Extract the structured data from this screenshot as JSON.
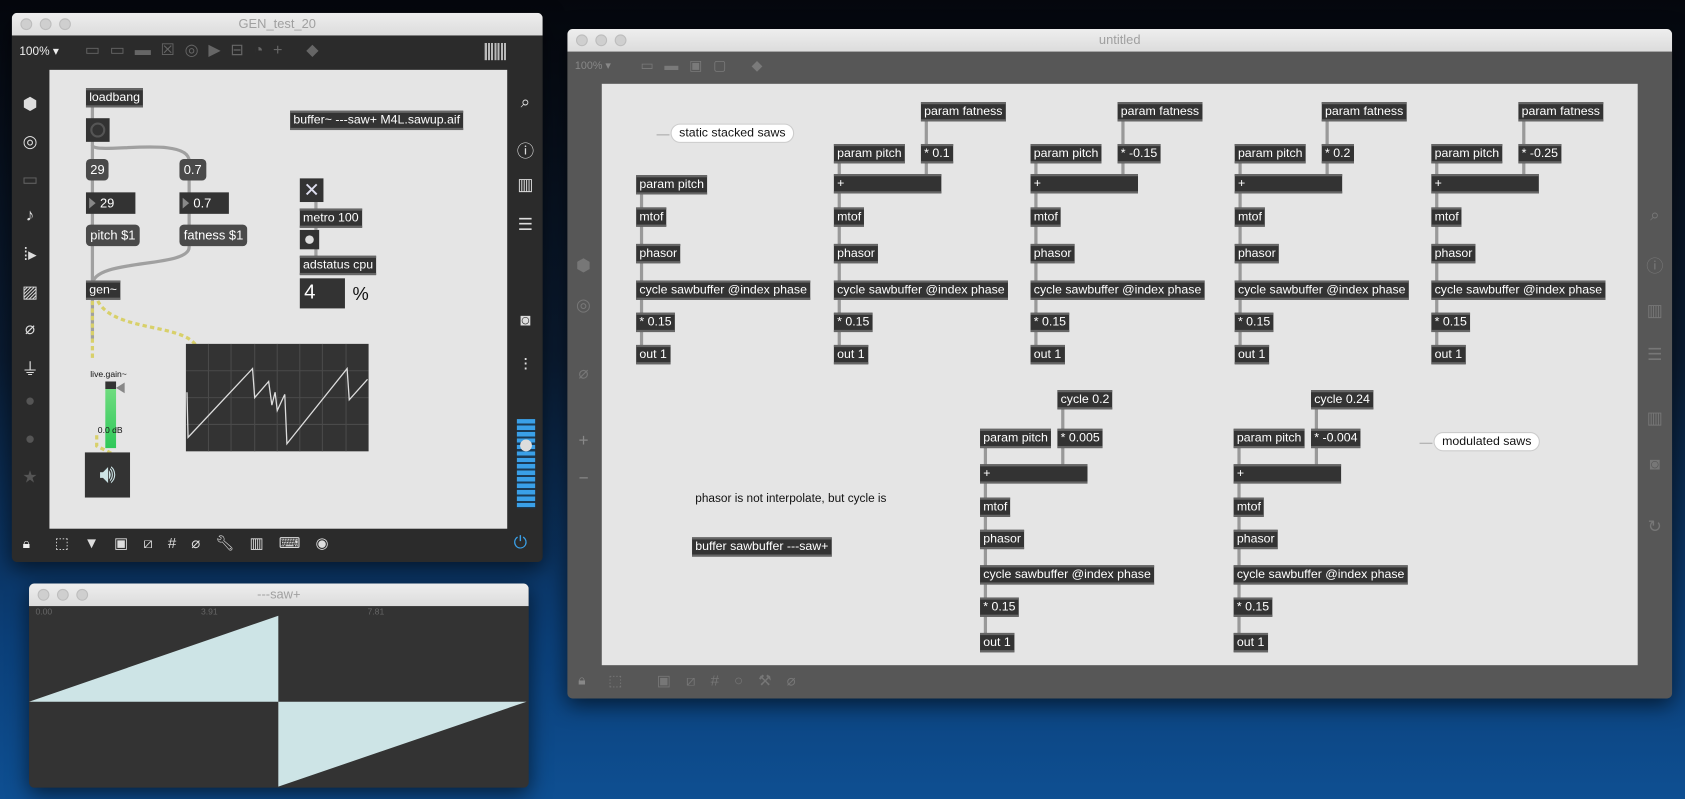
{
  "gen_window": {
    "title": "GEN_test_20",
    "zoom": "100%",
    "objects": {
      "loadbang": "loadbang",
      "msg_29": "29",
      "num_29": "29",
      "pitch_msg": "pitch $1",
      "msg_07": "0.7",
      "num_07": "0.7",
      "fatness_msg": "fatness $1",
      "gen": "gen~",
      "buffer": "buffer~ ---saw+ M4L.sawup.aif",
      "metro": "metro 100",
      "adstatus": "adstatus cpu",
      "cpu_value": "4",
      "percent": "%",
      "gain_label": "live.gain~",
      "gain_value": "0.0 dB"
    }
  },
  "buffer_window": {
    "title": "---saw+",
    "ticks": [
      "0.00",
      "3.91",
      "7.81"
    ],
    "fill_color": "#cde4e6"
  },
  "untitled_window": {
    "title": "untitled",
    "zoom": "100%",
    "comments": {
      "static": "static stacked saws",
      "modulated": "modulated saws",
      "note": "phasor is not interpolate, but cycle is"
    },
    "buffer_obj": "buffer sawbuffer ---saw+",
    "static_voices": [
      {
        "pitch": "param pitch",
        "mtof": "mtof",
        "phasor": "phasor",
        "cycle": "cycle sawbuffer @index phase",
        "gain": "* 0.15",
        "out": "out 1"
      },
      {
        "fatness": "param fatness",
        "mul": "* 0.1",
        "pitch": "param pitch",
        "add": "+",
        "mtof": "mtof",
        "phasor": "phasor",
        "cycle": "cycle sawbuffer @index phase",
        "gain": "* 0.15",
        "out": "out 1"
      },
      {
        "fatness": "param fatness",
        "mul": "* -0.15",
        "pitch": "param pitch",
        "add": "+",
        "mtof": "mtof",
        "phasor": "phasor",
        "cycle": "cycle sawbuffer @index phase",
        "gain": "* 0.15",
        "out": "out 1"
      },
      {
        "fatness": "param fatness",
        "mul": "* 0.2",
        "pitch": "param pitch",
        "add": "+",
        "mtof": "mtof",
        "phasor": "phasor",
        "cycle": "cycle sawbuffer @index phase",
        "gain": "* 0.15",
        "out": "out 1"
      },
      {
        "fatness": "param fatness",
        "mul": "* -0.25",
        "pitch": "param pitch",
        "add": "+",
        "mtof": "mtof",
        "phasor": "phasor",
        "cycle": "cycle sawbuffer @index phase",
        "gain": "* 0.15",
        "out": "out 1"
      }
    ],
    "mod_voices": [
      {
        "lfo": "cycle 0.2",
        "mul": "* 0.005",
        "pitch": "param pitch",
        "add": "+",
        "mtof": "mtof",
        "phasor": "phasor",
        "cycle": "cycle sawbuffer @index phase",
        "gain": "* 0.15",
        "out": "out 1"
      },
      {
        "lfo": "cycle 0.24",
        "mul": "* -0.004",
        "pitch": "param pitch",
        "add": "+",
        "mtof": "mtof",
        "phasor": "phasor",
        "cycle": "cycle sawbuffer @index phase",
        "gain": "* 0.15",
        "out": "out 1"
      }
    ]
  }
}
